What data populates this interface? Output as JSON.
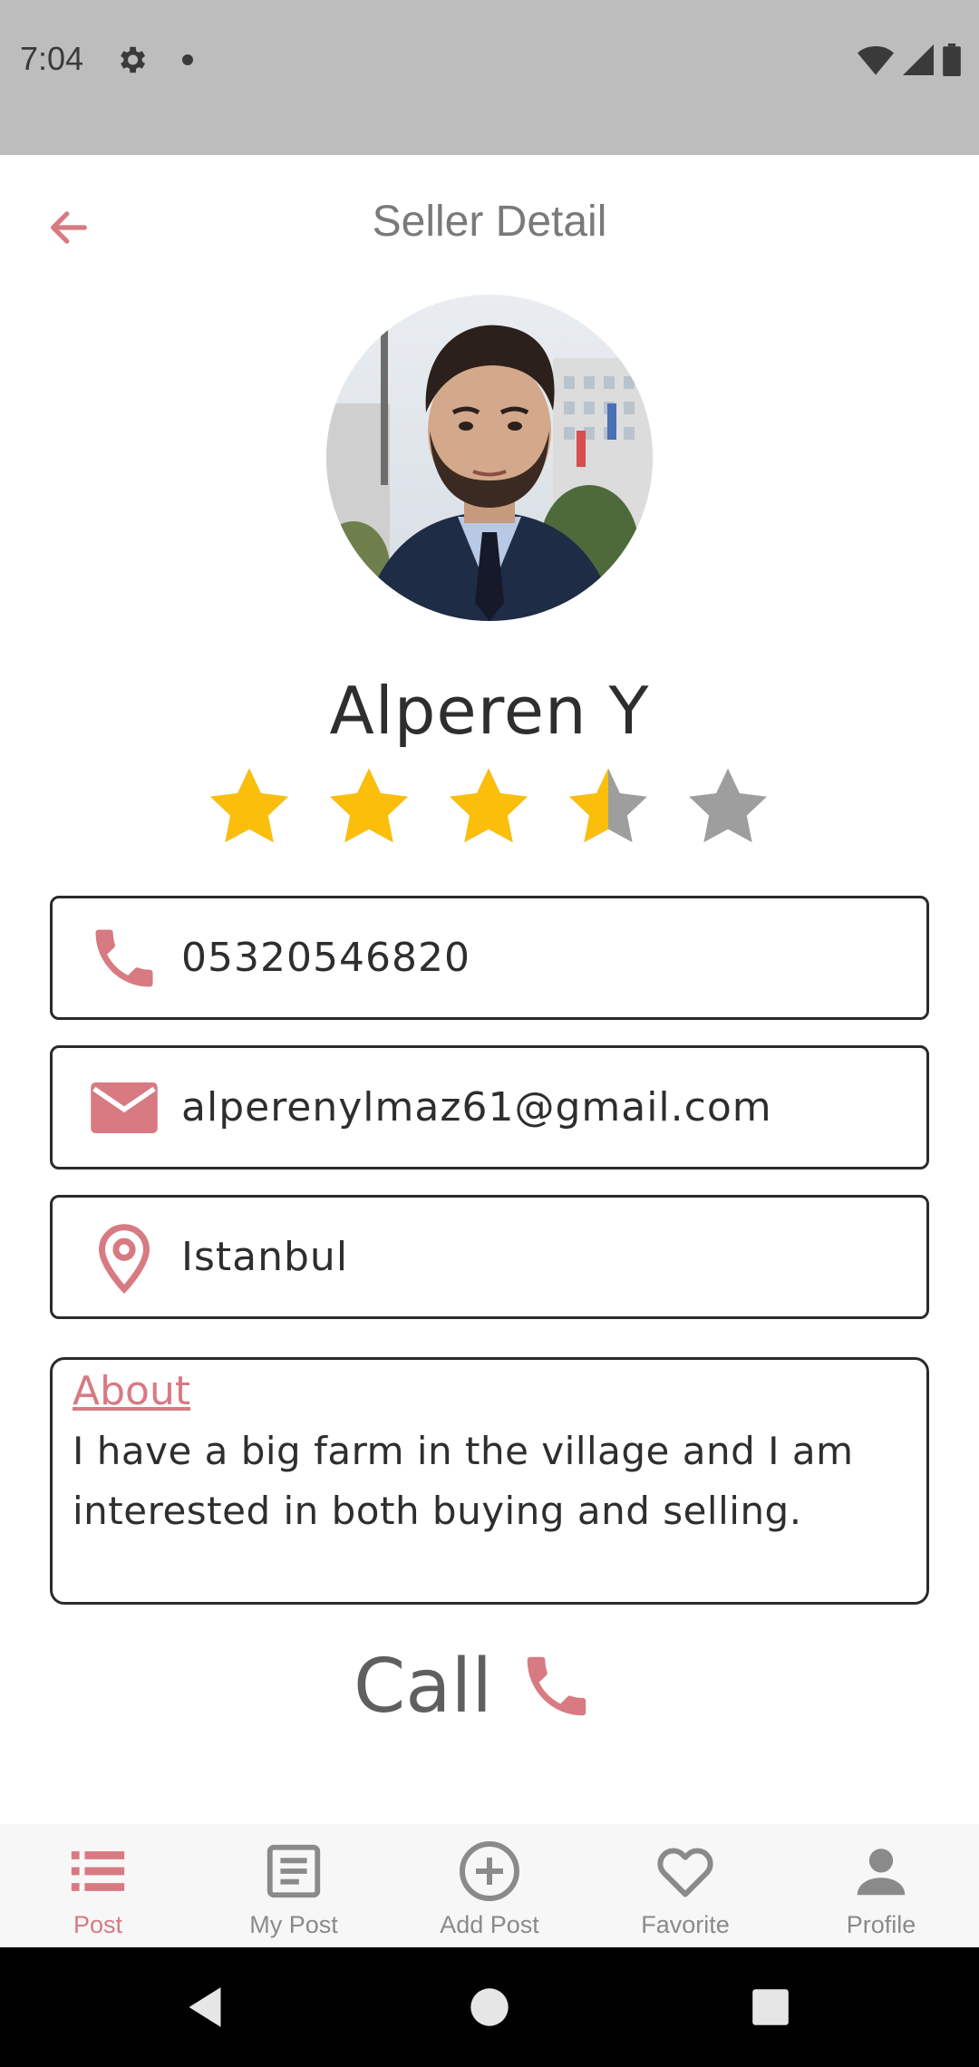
{
  "status_bar": {
    "time": "7:04"
  },
  "header": {
    "title": "Seller Detail"
  },
  "seller": {
    "name": "Alperen Y",
    "rating": 3.5,
    "rating_max": 5
  },
  "contact": {
    "phone": "05320546820",
    "email": "alperenylmaz61@gmail.com",
    "location": "Istanbul"
  },
  "about": {
    "title": "About",
    "text": "I have a big farm in the village and I am interested in both buying and selling."
  },
  "call": {
    "label": "Call"
  },
  "bottom_nav": {
    "items": [
      {
        "label": "Post",
        "icon": "list-icon",
        "active": true
      },
      {
        "label": "My Post",
        "icon": "document-icon",
        "active": false
      },
      {
        "label": "Add Post",
        "icon": "add-circle-icon",
        "active": false
      },
      {
        "label": "Favorite",
        "icon": "heart-icon",
        "active": false
      },
      {
        "label": "Profile",
        "icon": "person-icon",
        "active": false
      }
    ]
  },
  "colors": {
    "accent": "#d87a82",
    "star_filled": "#fbbf0b",
    "star_empty": "#9e9e9e",
    "status_bar": "#bdbdbd"
  }
}
